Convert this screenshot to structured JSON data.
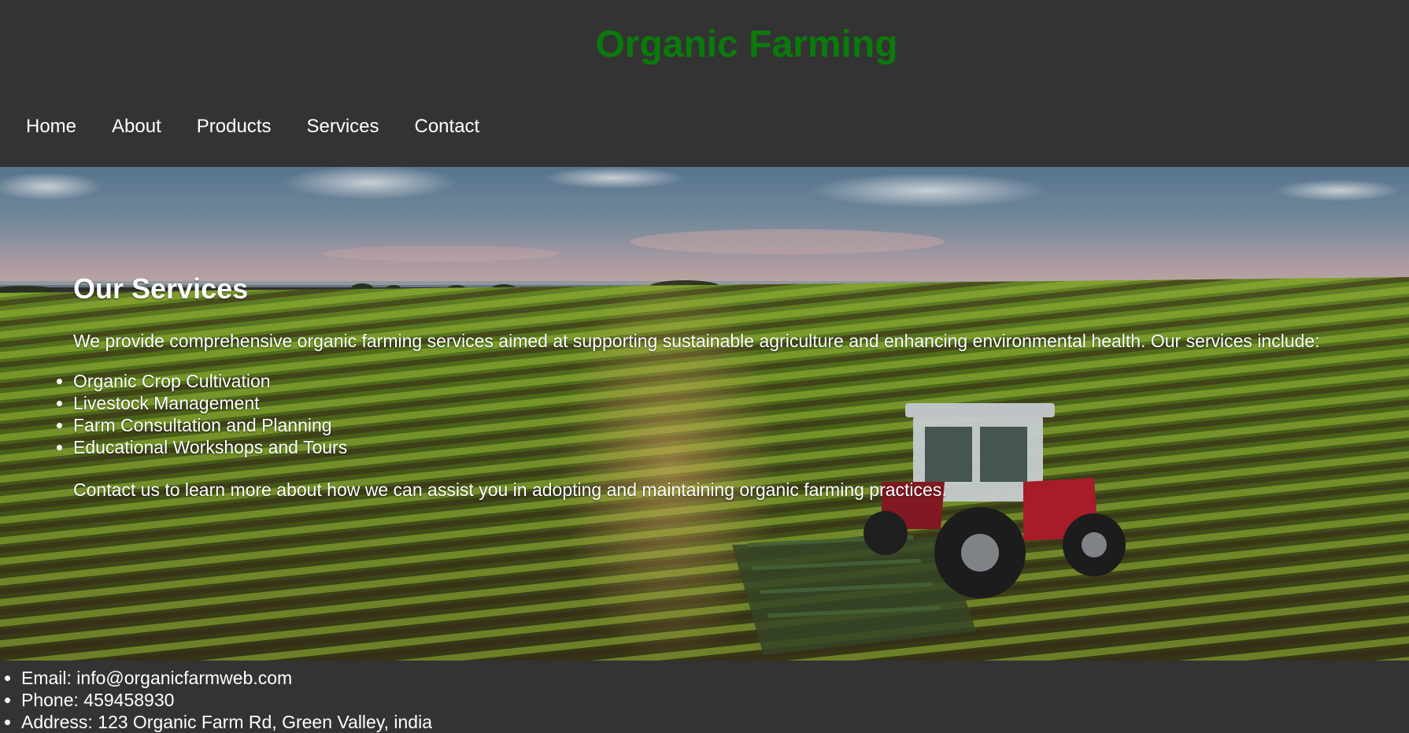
{
  "header": {
    "title": "Organic Farming",
    "title_color": "#0a7a0a",
    "background": "#333333"
  },
  "nav": {
    "items": [
      "Home",
      "About",
      "Products",
      "Services",
      "Contact"
    ]
  },
  "hero": {
    "image_description_icon": "farm-field-tractor-image"
  },
  "services": {
    "heading": "Our Services",
    "intro": "We provide comprehensive organic farming services aimed at supporting sustainable agriculture and enhancing environmental health. Our services include:",
    "items": [
      "Organic Crop Cultivation",
      "Livestock Management",
      "Farm Consultation and Planning",
      "Educational Workshops and Tours"
    ],
    "cta": "Contact us to learn more about how we can assist you in adopting and maintaining organic farming practices."
  },
  "footer": {
    "email": "Email: info@organicfarmweb.com",
    "phone": "Phone: 459458930",
    "address": "Address: 123 Organic Farm Rd, Green Valley, india"
  }
}
